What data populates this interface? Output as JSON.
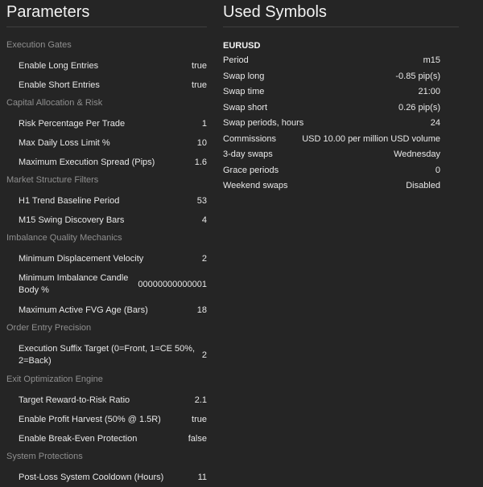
{
  "parameters": {
    "title": "Parameters",
    "sections": [
      {
        "name": "Execution Gates",
        "items": [
          {
            "label": "Enable Long Entries",
            "value": "true"
          },
          {
            "label": "Enable Short Entries",
            "value": "true"
          }
        ]
      },
      {
        "name": "Capital Allocation & Risk",
        "items": [
          {
            "label": "Risk Percentage Per Trade",
            "value": "1"
          },
          {
            "label": "Max Daily Loss Limit %",
            "value": "10"
          },
          {
            "label": "Maximum Execution Spread (Pips)",
            "value": "1.6"
          }
        ]
      },
      {
        "name": "Market Structure Filters",
        "items": [
          {
            "label": "H1 Trend Baseline Period",
            "value": "53"
          },
          {
            "label": "M15 Swing Discovery Bars",
            "value": "4"
          }
        ]
      },
      {
        "name": "Imbalance Quality Mechanics",
        "items": [
          {
            "label": "Minimum Displacement Velocity",
            "value": "2"
          },
          {
            "label": "Minimum Imbalance Candle Body %",
            "value": "000000000000001"
          },
          {
            "label": "Maximum Active FVG Age (Bars)",
            "value": "18"
          }
        ]
      },
      {
        "name": "Order Entry Precision",
        "items": [
          {
            "label": "Execution Suffix Target (0=Front, 1=CE 50%, 2=Back)",
            "value": "2"
          }
        ]
      },
      {
        "name": "Exit Optimization Engine",
        "items": [
          {
            "label": "Target Reward-to-Risk Ratio",
            "value": "2.1"
          },
          {
            "label": "Enable Profit Harvest (50% @ 1.5R)",
            "value": "true"
          },
          {
            "label": "Enable Break-Even Protection",
            "value": "false"
          }
        ]
      },
      {
        "name": "System Protections",
        "items": [
          {
            "label": "Post-Loss System Cooldown (Hours)",
            "value": "11"
          }
        ]
      }
    ]
  },
  "used_symbols": {
    "title": "Used Symbols",
    "symbol": "EURUSD",
    "rows": [
      {
        "label": "Period",
        "value": "m15"
      },
      {
        "label": "Swap long",
        "value": "-0.85 pip(s)"
      },
      {
        "label": "Swap time",
        "value": "21:00"
      },
      {
        "label": "Swap short",
        "value": "0.26 pip(s)"
      },
      {
        "label": "Swap periods, hours",
        "value": "24"
      },
      {
        "label": "Commissions",
        "value": "USD 10.00 per million USD volume"
      },
      {
        "label": "3-day swaps",
        "value": "Wednesday"
      },
      {
        "label": "Grace periods",
        "value": "0"
      },
      {
        "label": "Weekend swaps",
        "value": "Disabled"
      }
    ]
  }
}
